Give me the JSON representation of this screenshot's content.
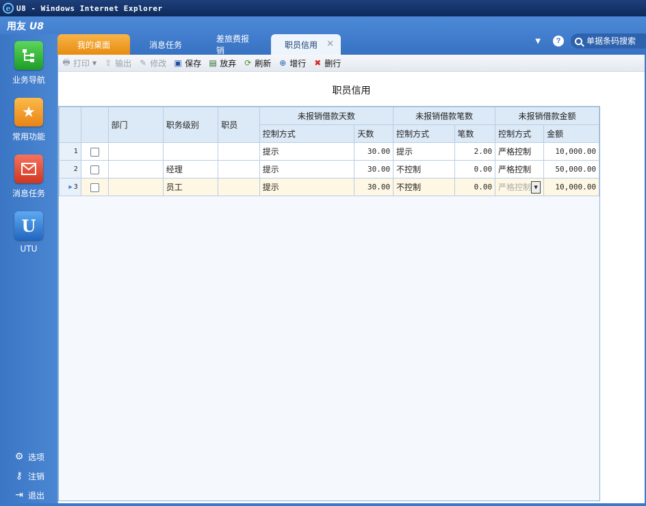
{
  "window": {
    "title": "U8 - Windows Internet Explorer"
  },
  "app": {
    "logo_a": "用友",
    "logo_b": "U8"
  },
  "tabs": [
    {
      "label": "我的桌面"
    },
    {
      "label": "消息任务"
    },
    {
      "label": "差旅费报销"
    },
    {
      "label": "职员信用"
    }
  ],
  "search": {
    "placeholder": "单据条码搜索"
  },
  "sidebar": {
    "items": [
      {
        "label": "业务导航",
        "icon": "org-chart-icon"
      },
      {
        "label": "常用功能",
        "icon": "star-folder-icon"
      },
      {
        "label": "消息任务",
        "icon": "mail-icon"
      },
      {
        "label": "UTU",
        "icon": "utu-icon"
      }
    ],
    "bottom": [
      {
        "label": "选项",
        "icon": "gear-icon"
      },
      {
        "label": "注销",
        "icon": "key-icon"
      },
      {
        "label": "退出",
        "icon": "exit-icon"
      }
    ]
  },
  "toolbar": {
    "print": "打印",
    "export": "输出",
    "edit": "修改",
    "save": "保存",
    "discard": "放弃",
    "refresh": "刷新",
    "add_row": "增行",
    "delete_row": "删行"
  },
  "page_title": "职员信用",
  "grid": {
    "headers": {
      "dept": "部门",
      "level": "职务级别",
      "employee": "职员",
      "group_days": "未报销借款天数",
      "group_count": "未报销借款笔数",
      "group_amount": "未报销借款金额",
      "control": "控制方式",
      "days": "天数",
      "count": "笔数",
      "amount": "金额"
    },
    "rows": [
      {
        "num": "1",
        "dept": "",
        "level": "",
        "employee": "",
        "days_ctrl": "提示",
        "days": "30.00",
        "count_ctrl": "提示",
        "count": "2.00",
        "amount_ctrl": "严格控制",
        "amount": "10,000.00"
      },
      {
        "num": "2",
        "dept": "",
        "level": "经理",
        "employee": "",
        "days_ctrl": "提示",
        "days": "30.00",
        "count_ctrl": "不控制",
        "count": "0.00",
        "amount_ctrl": "严格控制",
        "amount": "50,000.00"
      },
      {
        "num": "3",
        "dept": "",
        "level": "员工",
        "employee": "",
        "days_ctrl": "提示",
        "days": "30.00",
        "count_ctrl": "不控制",
        "count": "0.00",
        "amount_ctrl": "严格控制",
        "amount": "10,000.00"
      }
    ]
  }
}
